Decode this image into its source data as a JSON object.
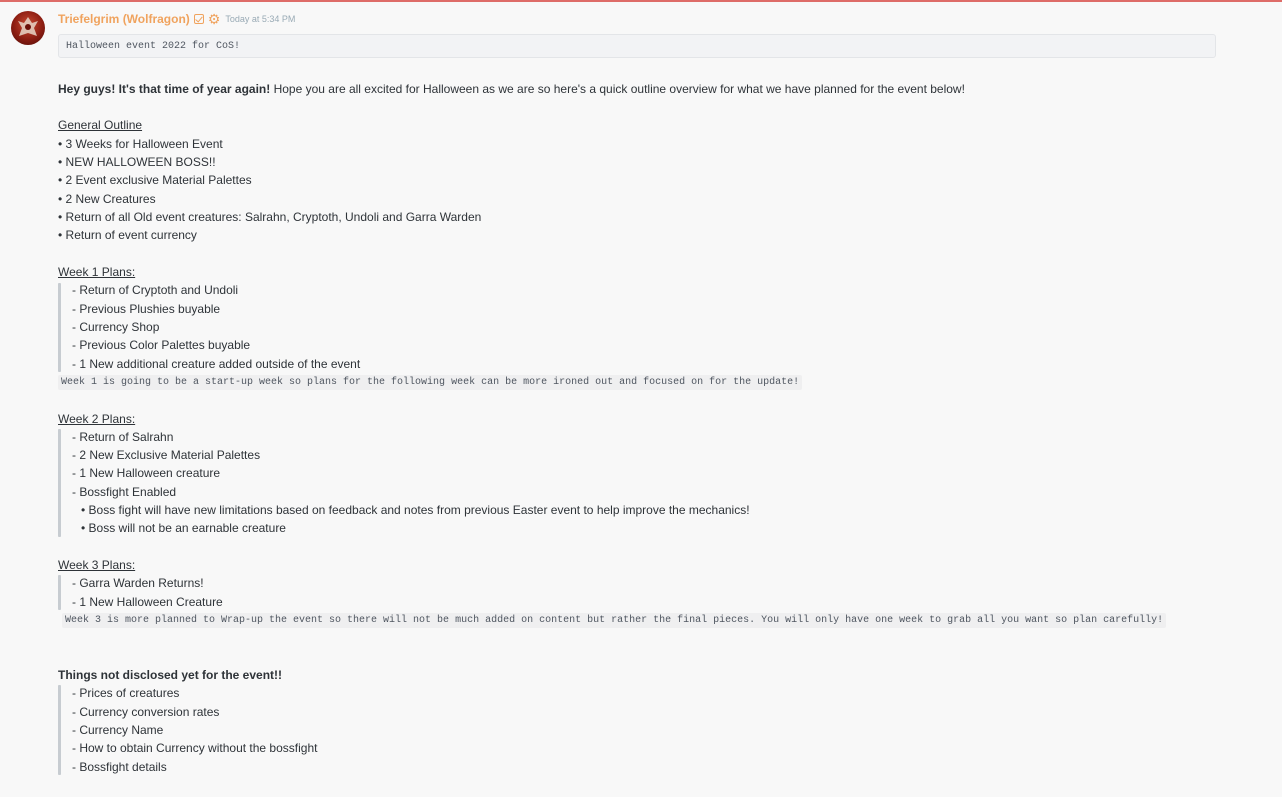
{
  "message": {
    "author": "Triefelgrim (Wolfragon)",
    "timestamp": "Today at 5:34 PM",
    "code_title": "Halloween event 2022 for CoS!",
    "intro_bold": "Hey guys! It's that time of year again!",
    "intro_rest": " Hope you are all excited for Halloween as we are so here's a quick outline overview for what we have planned for the event below!",
    "general": {
      "heading": "General Outline",
      "items": [
        "• 3 Weeks for Halloween Event",
        "• NEW HALLOWEEN BOSS!!",
        "• 2 Event exclusive Material Palettes",
        "• 2 New Creatures",
        "• Return of all Old event creatures: Salrahn, Cryptoth, Undoli and Garra Warden",
        "• Return of event currency"
      ]
    },
    "week1": {
      "heading": "Week 1 Plans:",
      "items": [
        "- Return of  Cryptoth and Undoli",
        "- Previous Plushies buyable",
        "- Currency Shop",
        "- Previous Color Palettes buyable",
        "- 1 New additional creature added outside of the event"
      ],
      "note": "Week 1 is going to be a start-up week so plans for the following week can be more ironed out and focused on for the update!"
    },
    "week2": {
      "heading": "Week 2 Plans:",
      "items": [
        "- Return of Salrahn",
        "- 2 New Exclusive Material Palettes",
        "- 1 New Halloween creature",
        "- Bossfight Enabled"
      ],
      "subitems": [
        "• Boss fight will have new limitations based on feedback and notes from previous Easter event to help improve the mechanics!",
        "• Boss will not be an earnable creature"
      ]
    },
    "week3": {
      "heading": "Week 3 Plans:",
      "items": [
        "- Garra Warden Returns!",
        "- 1 New Halloween Creature"
      ],
      "note": "Week 3 is more planned to Wrap-up the event so there will not be much added on content but rather the final pieces. You will only have one week to grab all you want so plan carefully!"
    },
    "undisclosed": {
      "heading": "Things not disclosed yet for the event!!",
      "items": [
        "- Prices of creatures",
        "- Currency conversion rates",
        "- Currency Name",
        "- How to obtain Currency without the bossfight",
        "- Bossfight details"
      ]
    }
  },
  "icons": {
    "verified": "check-square-icon",
    "role": "gear-icon"
  },
  "colors": {
    "username": "#f0a35e",
    "quote_bar": "#c7ccd1",
    "background": "#f8f8f8"
  }
}
